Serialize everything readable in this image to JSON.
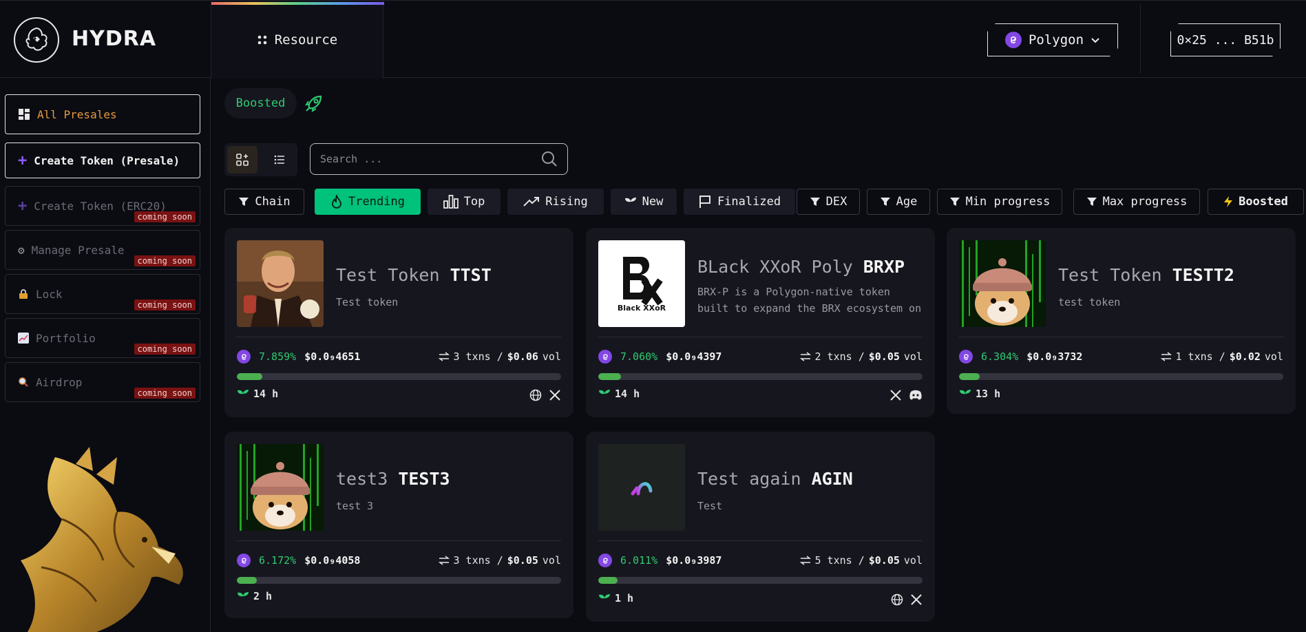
{
  "app": {
    "brand": "HYDRA"
  },
  "header": {
    "resource_label": "Resource",
    "chain_label": "Polygon",
    "wallet_label": "0×25 ... B51b"
  },
  "sidebar": {
    "items": [
      {
        "label": "All Presales",
        "badge": ""
      },
      {
        "label": "Create Token (Presale)",
        "badge": ""
      },
      {
        "label": "Create Token (ERC20)",
        "badge": "coming soon"
      },
      {
        "label": "Manage Presale",
        "badge": "coming soon"
      },
      {
        "label": "Lock",
        "badge": "coming soon"
      },
      {
        "label": "Portfolio",
        "badge": "coming soon"
      },
      {
        "label": "Airdrop",
        "badge": "coming soon"
      }
    ]
  },
  "main": {
    "boosted_tab": "Boosted",
    "search_placeholder": "Search ...",
    "filters": [
      "Chain",
      "Trending",
      "Top",
      "Rising",
      "New",
      "Finalized",
      "DEX",
      "Age",
      "Min progress",
      "Max progress",
      "Boosted"
    ],
    "cards": [
      {
        "name": "Test Token",
        "symbol": "TTST",
        "desc": "Test token",
        "pct": "7.859%",
        "price": "$0.0₉4651",
        "txns": "3 txns /",
        "vol": "$0.06",
        "vol_unit": "vol",
        "progress": 0.078,
        "age": "14 h"
      },
      {
        "name": "BLack XXoR Poly",
        "symbol": "BRXP",
        "desc": "BRX-P is a Polygon-native token built to expand the BRX ecosystem on ...",
        "pct": "7.060%",
        "price": "$0.0₉4397",
        "txns": "2 txns /",
        "vol": "$0.05",
        "vol_unit": "vol",
        "progress": 0.07,
        "age": "14 h",
        "logo_text": "Black XXoR"
      },
      {
        "name": "Test Token",
        "symbol": "TESTT2",
        "desc": "test token",
        "pct": "6.304%",
        "price": "$0.0₉3732",
        "txns": "1 txns /",
        "vol": "$0.02",
        "vol_unit": "vol",
        "progress": 0.063,
        "age": "13 h"
      },
      {
        "name": "test3",
        "symbol": "TEST3",
        "desc": "test 3",
        "pct": "6.172%",
        "price": "$0.0₉4058",
        "txns": "3 txns /",
        "vol": "$0.05",
        "vol_unit": "vol",
        "progress": 0.062,
        "age": "2 h"
      },
      {
        "name": "Test again",
        "symbol": "AGIN",
        "desc": "Test",
        "pct": "6.011%",
        "price": "$0.0₉3987",
        "txns": "5 txns /",
        "vol": "$0.05",
        "vol_unit": "vol",
        "progress": 0.06,
        "age": "1 h"
      }
    ]
  }
}
